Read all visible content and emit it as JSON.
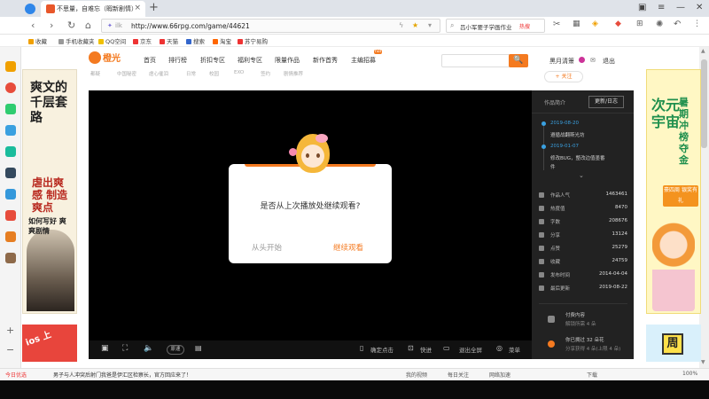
{
  "browser": {
    "tab_title": "不思量，自难忘（暇新剧情）",
    "new_tab": "+",
    "url_prefix": "ilk",
    "url": "http://www.66rpg.com/game/44621",
    "search_text": "吕小军要子学画作业",
    "search_hot": "热搜",
    "bookmarks_label": "收藏",
    "bookmarks": [
      "手机收藏夹",
      "QQ空间",
      "京东",
      "天猫",
      "搜索",
      "淘宝",
      "苏宁易购"
    ]
  },
  "site": {
    "logo": "橙光",
    "nav": [
      "首页",
      "排行榜",
      "折扣专区",
      "福利专区",
      "限量作品",
      "新作首秀",
      "主编招募"
    ],
    "nav_badge": "hot",
    "search_btn": "🔍",
    "user": [
      "黑月清箫",
      "退出"
    ],
    "tags": [
      "都疑",
      "中国秘密",
      "虐心催泪",
      "日常",
      "校园",
      "EXO",
      "签约",
      "剧情推荐"
    ],
    "follow": "+ 关注"
  },
  "dialog": {
    "question": "是否从上次播放处继续观看?",
    "restart": "从头开始",
    "continue": "继续观看"
  },
  "controls": {
    "speed": "原速",
    "confirm": "确定点击",
    "fast": "快进",
    "exit_fullscreen": "退出全屏",
    "menu": "菜单"
  },
  "panel": {
    "tab_intro": "作品简介",
    "tab_updates": "更新/日志",
    "updates": [
      {
        "date": "2019-08-20",
        "text": "遵循战翻斯光坊"
      },
      {
        "date": "2019-01-07",
        "text": "修改BUG，整改边值墨番",
        "text2": "件"
      }
    ],
    "stats": [
      {
        "label": "作品人气",
        "value": "1463461"
      },
      {
        "label": "热度值",
        "value": "8470"
      },
      {
        "label": "字数",
        "value": "208676"
      },
      {
        "label": "分享",
        "value": "13124"
      },
      {
        "label": "点赞",
        "value": "25279"
      },
      {
        "label": "收藏",
        "value": "24759"
      },
      {
        "label": "发布时间",
        "value": "2014-04-04"
      },
      {
        "label": "最后更新",
        "value": "2019-08-22"
      }
    ],
    "pay_title": "付费内容",
    "pay_sub": "解锁所需 4 朵",
    "gift_title": "你已拥过 32 朵花",
    "gift_sub": "分享获得 4 朵(上限 4 朵)"
  },
  "ads": {
    "left_top": "爽文的千层套路",
    "left_red": "虐出爽感 制造爽点",
    "left_bottom": "如何写好 爽爽剧情",
    "left2": "ios 上",
    "right_big": "次元宇宙",
    "right_sub": "暑期冲榜夺金",
    "right_gift": "豪四周 银奖有礼",
    "right2": "周"
  },
  "statusbar": {
    "left": "今日优选",
    "news": "男子与人冲突后射门我爸是伊汇区检察长，官方回应来了！",
    "items": [
      "我的视频",
      "每日关注",
      "网络加速",
      "下载"
    ],
    "zoom": "100%"
  }
}
